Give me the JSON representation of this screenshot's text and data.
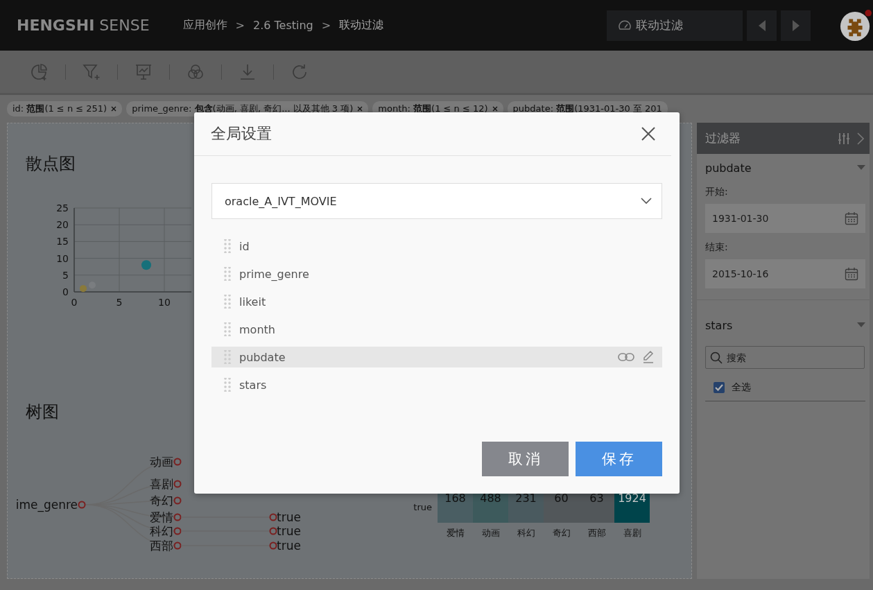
{
  "header": {
    "logo_bold": "HENGSHI",
    "logo_light": "SENSE",
    "breadcrumb": [
      {
        "kind": "link",
        "label": "应用创作"
      },
      {
        "kind": "separator",
        "label": ">"
      },
      {
        "kind": "link",
        "label": "2.6 Testing"
      },
      {
        "kind": "separator",
        "label": ">"
      },
      {
        "kind": "current",
        "label": "联动过滤"
      }
    ],
    "dashboard_button": "联动过滤"
  },
  "filter_chips": [
    {
      "text": "id: **范围**(1 ≤ n ≤ 251)",
      "closable": true
    },
    {
      "text": "prime_genre: **包含**(动画, 喜剧, 奇幻... 以及其他 3 项)",
      "closable": true
    },
    {
      "text": "month: **范围**(1 ≤ n ≤ 12)",
      "closable": true
    },
    {
      "text": "pubdate: **范围**(1931-01-30 至 201",
      "closable": false
    }
  ],
  "scatter": {
    "title": "散点图",
    "chart_data": {
      "type": "scatter",
      "x": [
        1,
        2,
        8
      ],
      "series": [
        {
          "color": "#8a7a3a",
          "values": [
            1,
            null,
            null
          ]
        },
        {
          "color": "#7a7d80",
          "values": [
            null,
            2,
            null
          ]
        },
        {
          "color": "#17707a",
          "values": [
            null,
            null,
            8
          ]
        }
      ],
      "xticks": [
        0,
        5,
        10
      ],
      "yticks": [
        0,
        5,
        10,
        15,
        20,
        25
      ],
      "xlim": [
        0,
        13
      ],
      "ylim": [
        0,
        25
      ],
      "grid": true
    }
  },
  "tree": {
    "title": "树图",
    "root": "ime_genre",
    "children": [
      {
        "label": "动画"
      },
      {
        "label": "喜剧"
      },
      {
        "label": "奇幻"
      },
      {
        "label": "爱情",
        "children": [
          {
            "label": "true"
          }
        ]
      },
      {
        "label": "科幻",
        "children": [
          {
            "label": "true"
          }
        ]
      },
      {
        "label": "西部",
        "children": [
          {
            "label": "true"
          }
        ]
      }
    ]
  },
  "heatmap": {
    "row_label": "true",
    "cells": [
      {
        "label": "爱情",
        "value": "168",
        "color": "#4a5e63"
      },
      {
        "label": "动画",
        "value": "488",
        "color": "#3d5a5c"
      },
      {
        "label": "科幻",
        "value": "231",
        "color": "#4a5a5f"
      },
      {
        "label": "奇幻",
        "value": "60",
        "color": "#52575a"
      },
      {
        "label": "西部",
        "value": "63",
        "color": "#52575a"
      },
      {
        "label": "喜剧",
        "value": "1924",
        "color": "#00444b"
      }
    ]
  },
  "filter_panel": {
    "title": "过滤器",
    "sections": [
      {
        "kind": "date_range",
        "field": "pubdate",
        "start_label": "开始:",
        "start": "1931-01-30",
        "end_label": "结束:",
        "end": "2015-10-16"
      },
      {
        "kind": "list",
        "field": "stars",
        "search_placeholder": "搜索",
        "select_all": {
          "label": "全选",
          "checked": true
        }
      }
    ]
  },
  "dialog": {
    "title": "全局设置",
    "dataset": "oracle_A_IVT_MOVIE",
    "fields": [
      {
        "name": "id",
        "selected": false
      },
      {
        "name": "prime_genre",
        "selected": false
      },
      {
        "name": "likeit",
        "selected": false
      },
      {
        "name": "month",
        "selected": false
      },
      {
        "name": "pubdate",
        "selected": true
      },
      {
        "name": "stars",
        "selected": false
      }
    ],
    "buttons": [
      {
        "kind": "cancel",
        "label": "取消"
      },
      {
        "kind": "save",
        "label": "保存"
      }
    ]
  }
}
